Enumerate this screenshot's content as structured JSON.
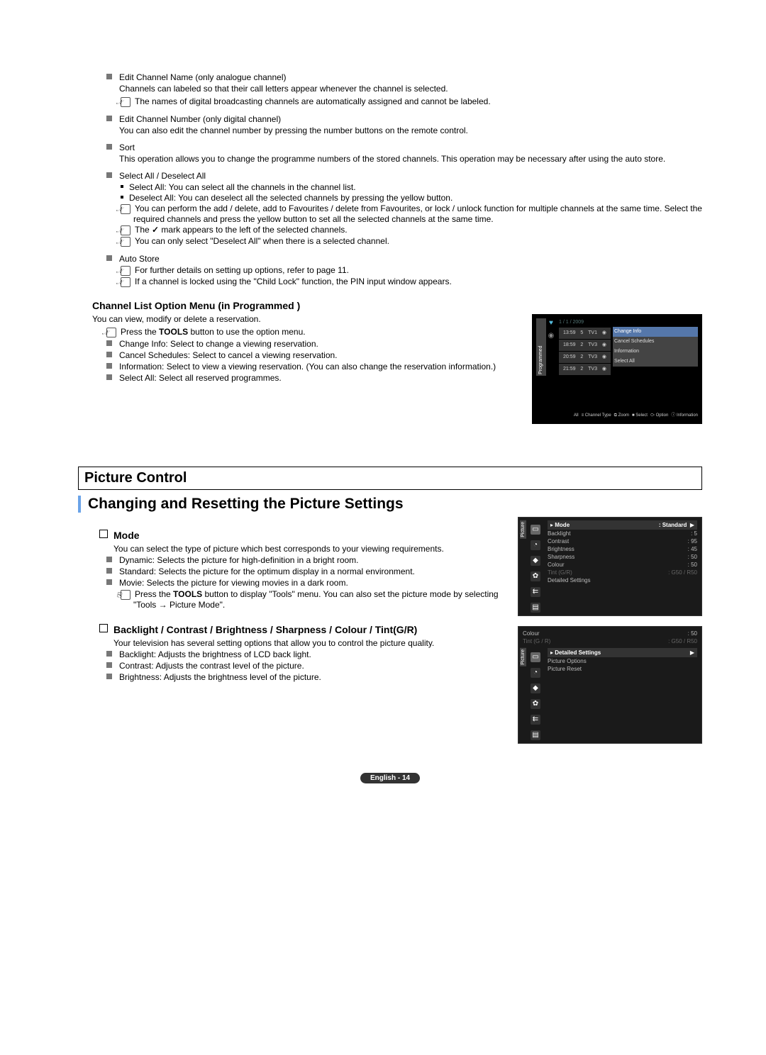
{
  "s1": {
    "i1_title": "Edit Channel Name (only analogue channel)",
    "i1_desc": "Channels can labeled so that their call letters appear whenever the channel is selected.",
    "i1_note": "The names of digital broadcasting channels are automatically assigned and cannot be labeled.",
    "i2_title": "Edit Channel Number (only digital channel)",
    "i2_desc": "You can also edit the channel number by pressing the number buttons on the remote control.",
    "i3_title": "Sort",
    "i3_desc": "This operation allows you to change the programme numbers of the stored channels. This operation may be necessary after using the auto store.",
    "i4_title": "Select All / Deselect All",
    "i4_b1": "Select All: You can select all the channels in the channel list.",
    "i4_b2": "Deselect All: You can deselect all the selected channels by pressing the yellow button.",
    "i4_n1": "You can perform the add / delete, add to Favourites / delete from Favourites, or lock / unlock function for multiple channels at the same time. Select the required channels and press the yellow button to set all the selected channels at the same time.",
    "i4_n2a": "The ",
    "i4_n2b": " mark appears to the left of the selected channels.",
    "i4_n3": "You can only select \"Deselect All\" when there is a selected channel.",
    "i5_title": "Auto Store",
    "i5_n1": "For further details on setting up options, refer to page 11.",
    "i5_n2": "If a channel is locked using the \"Child Lock\" function, the PIN input window appears."
  },
  "s2": {
    "heading": "Channel List Option Menu (in Programmed )",
    "intro": "You can view, modify or delete a reservation.",
    "n1a": "Press the ",
    "n1b": "TOOLS",
    "n1c": " button to use the option menu.",
    "b1": "Change Info: Select to change a viewing reservation.",
    "b2": "Cancel Schedules: Select to cancel a viewing reservation.",
    "b3": "Information: Select to view a viewing reservation. (You can also change the reservation information.)",
    "b4": "Select All: Select all reserved programmes."
  },
  "fig1": {
    "side": "Programmed",
    "date": "1 / 1 / 2009",
    "rows": [
      {
        "t": "13:59",
        "n": "5",
        "c": "TV1"
      },
      {
        "t": "18:59",
        "n": "2",
        "c": "TV3"
      },
      {
        "t": "20:59",
        "n": "2",
        "c": "TV3"
      },
      {
        "t": "21:59",
        "n": "2",
        "c": "TV3"
      }
    ],
    "menu": [
      "Change Info",
      "Cancel Schedules",
      "Information",
      "Select All"
    ],
    "foot_all": "All",
    "foot_ct": "Channel Type",
    "foot_zoom": "Zoom",
    "foot_sel": "Select",
    "foot_opt": "Option",
    "foot_info": "Information"
  },
  "s3": {
    "h1": "Picture Control",
    "h2": "Changing and Resetting the Picture Settings",
    "mode_t": "Mode",
    "mode_intro": "You can select the type of picture which best corresponds to your viewing requirements.",
    "mode_b1": "Dynamic: Selects the picture for high-definition in a bright room.",
    "mode_b2": "Standard: Selects the picture for the optimum display in a normal environment.",
    "mode_b3": "Movie: Selects the picture for viewing movies in a dark room.",
    "mode_na": "Press the ",
    "mode_nb": "TOOLS",
    "mode_nc": " button to display \"Tools\" menu. You can also set the picture mode by selecting \"Tools → Picture Mode\".",
    "bc_t": "Backlight / Contrast / Brightness / Sharpness / Colour / Tint(G/R)",
    "bc_intro": "Your television has several setting options that allow you to control the picture quality.",
    "bc_b1": "Backlight: Adjusts the brightness of LCD back light.",
    "bc_b2": "Contrast: Adjusts the contrast level of the picture.",
    "bc_b3": "Brightness: Adjusts the brightness level of the picture."
  },
  "osd1": {
    "side": "Picture",
    "mode": "Mode",
    "mode_v": ": Standard",
    "l": [
      {
        "k": "Backlight",
        "v": ": 5"
      },
      {
        "k": "Contrast",
        "v": ": 95"
      },
      {
        "k": "Brightness",
        "v": ": 45"
      },
      {
        "k": "Sharpness",
        "v": ": 50"
      },
      {
        "k": "Colour",
        "v": ": 50"
      },
      {
        "k": "Tint (G/R)",
        "v": ": G50 / R50"
      },
      {
        "k": "Detailed Settings",
        "v": ""
      }
    ]
  },
  "osd2": {
    "side": "Picture",
    "top": [
      {
        "k": "Colour",
        "v": ": 50"
      },
      {
        "k": "Tint (G / R)",
        "v": ": G50 / R50"
      }
    ],
    "hdr": "Detailed Settings",
    "bot": [
      "Picture Options",
      "Picture Reset"
    ]
  },
  "footer": "English - 14",
  "check_mark": "✓",
  "arrow": "▶"
}
